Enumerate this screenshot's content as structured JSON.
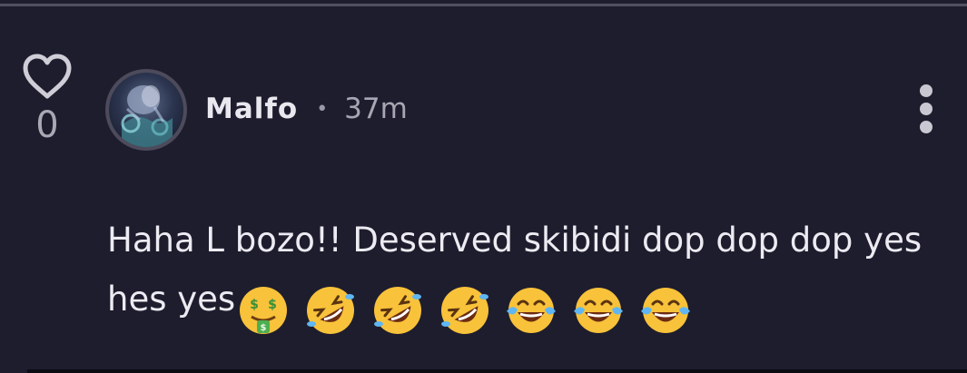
{
  "comment": {
    "likes": {
      "count": "0",
      "icon": "heart-outline-icon"
    },
    "author": {
      "username": "Malfo",
      "avatar": "avatar-image"
    },
    "separator": "•",
    "timestamp": "37m",
    "text": "Haha L bozo!! Deserved skibidi dop dop dop yes hes yes",
    "emojis": [
      "money-mouth-face-icon",
      "rolling-on-floor-laughing-icon",
      "rolling-on-floor-laughing-icon",
      "rolling-on-floor-laughing-icon",
      "face-with-tears-of-joy-icon",
      "face-with-tears-of-joy-icon",
      "face-with-tears-of-joy-icon"
    ],
    "menu_icon": "vertical-ellipsis-icon"
  },
  "colors": {
    "background": "#1e1d2e",
    "text_primary": "#ecebf2",
    "text_muted": "#a7a6b2",
    "divider": "#52505f",
    "emoji_yellow": "#f8c23a"
  }
}
